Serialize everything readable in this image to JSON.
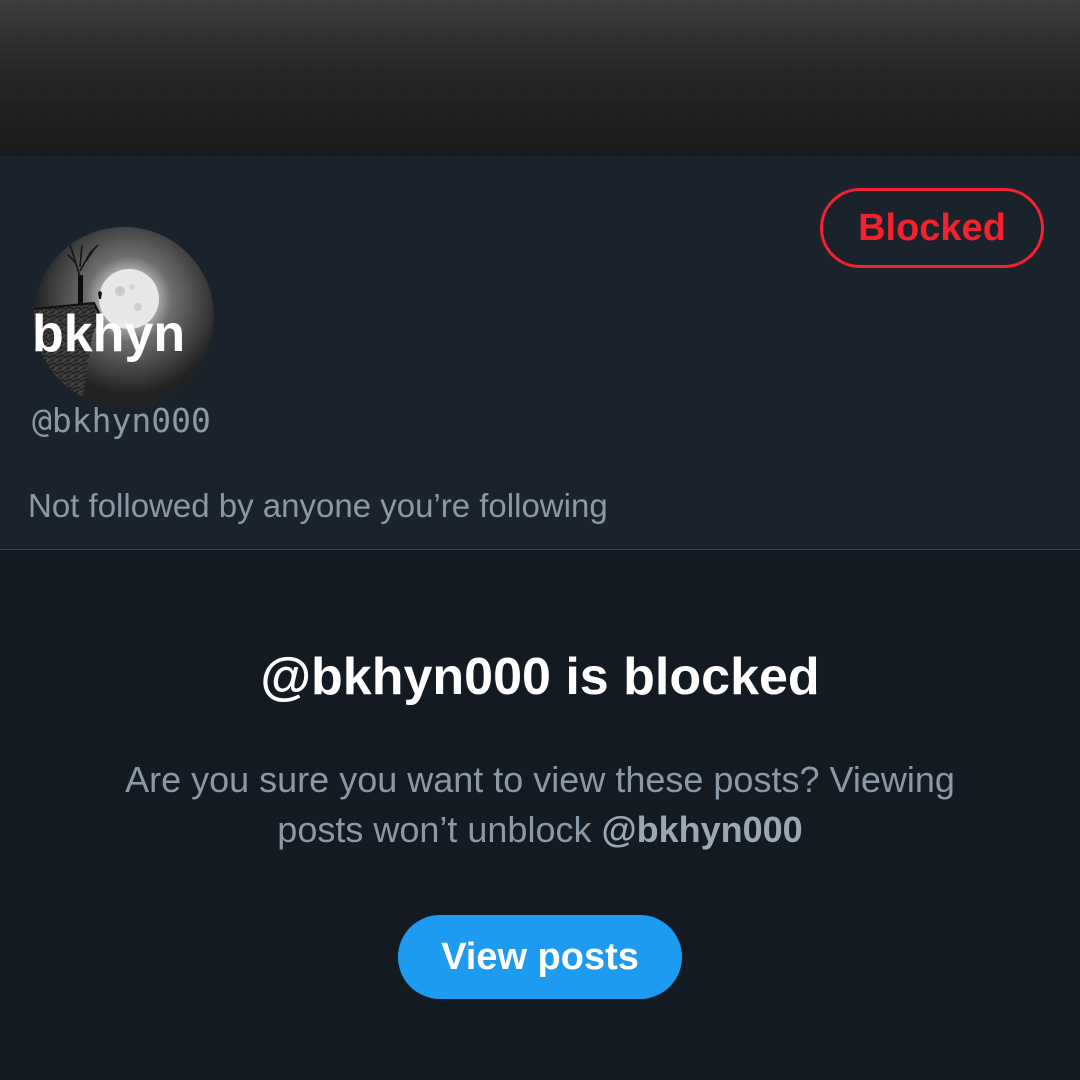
{
  "profile": {
    "display_name": "bkhyn",
    "handle": "@bkhyn000",
    "followed_by": "Not followed by anyone you’re following",
    "avatar": "moon-cliff-tree-image",
    "banner": "dark-gray-texture"
  },
  "actions": {
    "blocked_label": "Blocked",
    "view_posts_label": "View posts"
  },
  "blocked_notice": {
    "title": "@bkhyn000 is blocked",
    "description": "Are you sure you want to view these posts? Viewing posts won’t unblock",
    "mention": "@bkhyn000"
  },
  "colors": {
    "accent_blue": "#1d9bf0",
    "danger_red": "#f4212e",
    "header_bg": "#1a222c",
    "body_bg": "#141a21",
    "muted_text": "#8b98a5"
  }
}
